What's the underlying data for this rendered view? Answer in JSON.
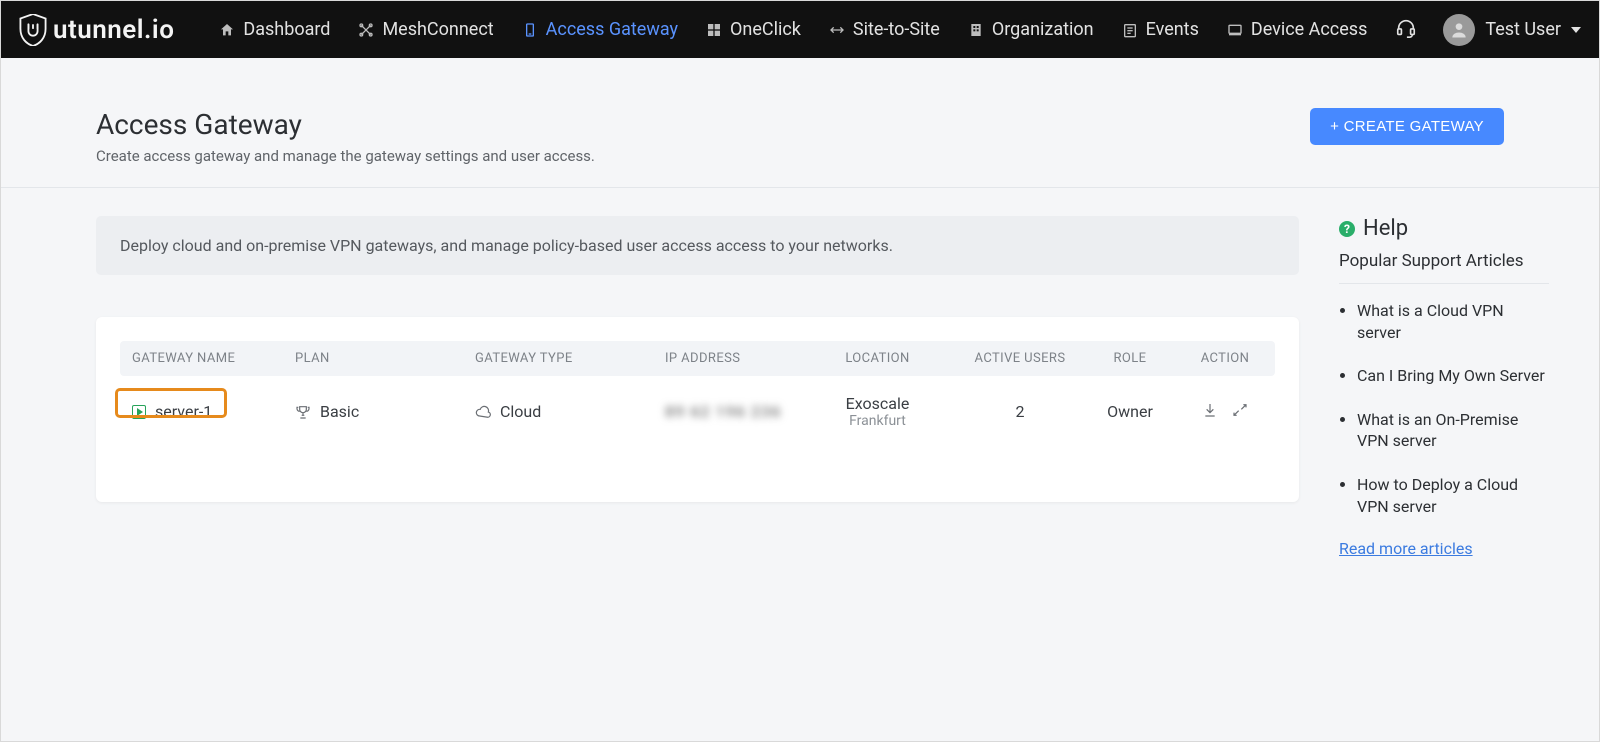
{
  "brand": {
    "name": "utunnel.io"
  },
  "nav": {
    "items": [
      {
        "label": "Dashboard",
        "icon": "home-icon",
        "active": false
      },
      {
        "label": "MeshConnect",
        "icon": "mesh-icon",
        "active": false
      },
      {
        "label": "Access Gateway",
        "icon": "gateway-icon",
        "active": true
      },
      {
        "label": "OneClick",
        "icon": "oneclick-icon",
        "active": false
      },
      {
        "label": "Site-to-Site",
        "icon": "sitetosite-icon",
        "active": false
      },
      {
        "label": "Organization",
        "icon": "organization-icon",
        "active": false
      },
      {
        "label": "Events",
        "icon": "events-icon",
        "active": false
      },
      {
        "label": "Device Access",
        "icon": "deviceaccess-icon",
        "active": false
      }
    ]
  },
  "user": {
    "display_name": "Test User"
  },
  "page": {
    "title": "Access Gateway",
    "subtitle": "Create access gateway and manage the gateway settings and user access.",
    "create_button": "+ CREATE GATEWAY",
    "banner": "Deploy cloud and on-premise VPN gateways, and manage policy-based user access access to your networks."
  },
  "table": {
    "headers": {
      "name": "GATEWAY NAME",
      "plan": "PLAN",
      "type": "GATEWAY TYPE",
      "ip": "IP ADDRESS",
      "location": "LOCATION",
      "users": "ACTIVE USERS",
      "role": "ROLE",
      "action": "ACTION"
    },
    "rows": [
      {
        "name": "server-1",
        "plan": "Basic",
        "type": "Cloud",
        "ip": "89 62 196 236",
        "location_main": "Exoscale",
        "location_sub": "Frankfurt",
        "active_users": "2",
        "role": "Owner"
      }
    ]
  },
  "help": {
    "title": "Help",
    "subtitle": "Popular Support Articles",
    "articles": [
      "What is a Cloud VPN server",
      "Can I Bring My Own Server",
      "What is an On-Premise VPN server",
      "How to Deploy a Cloud VPN server"
    ],
    "read_more": "Read more articles"
  }
}
